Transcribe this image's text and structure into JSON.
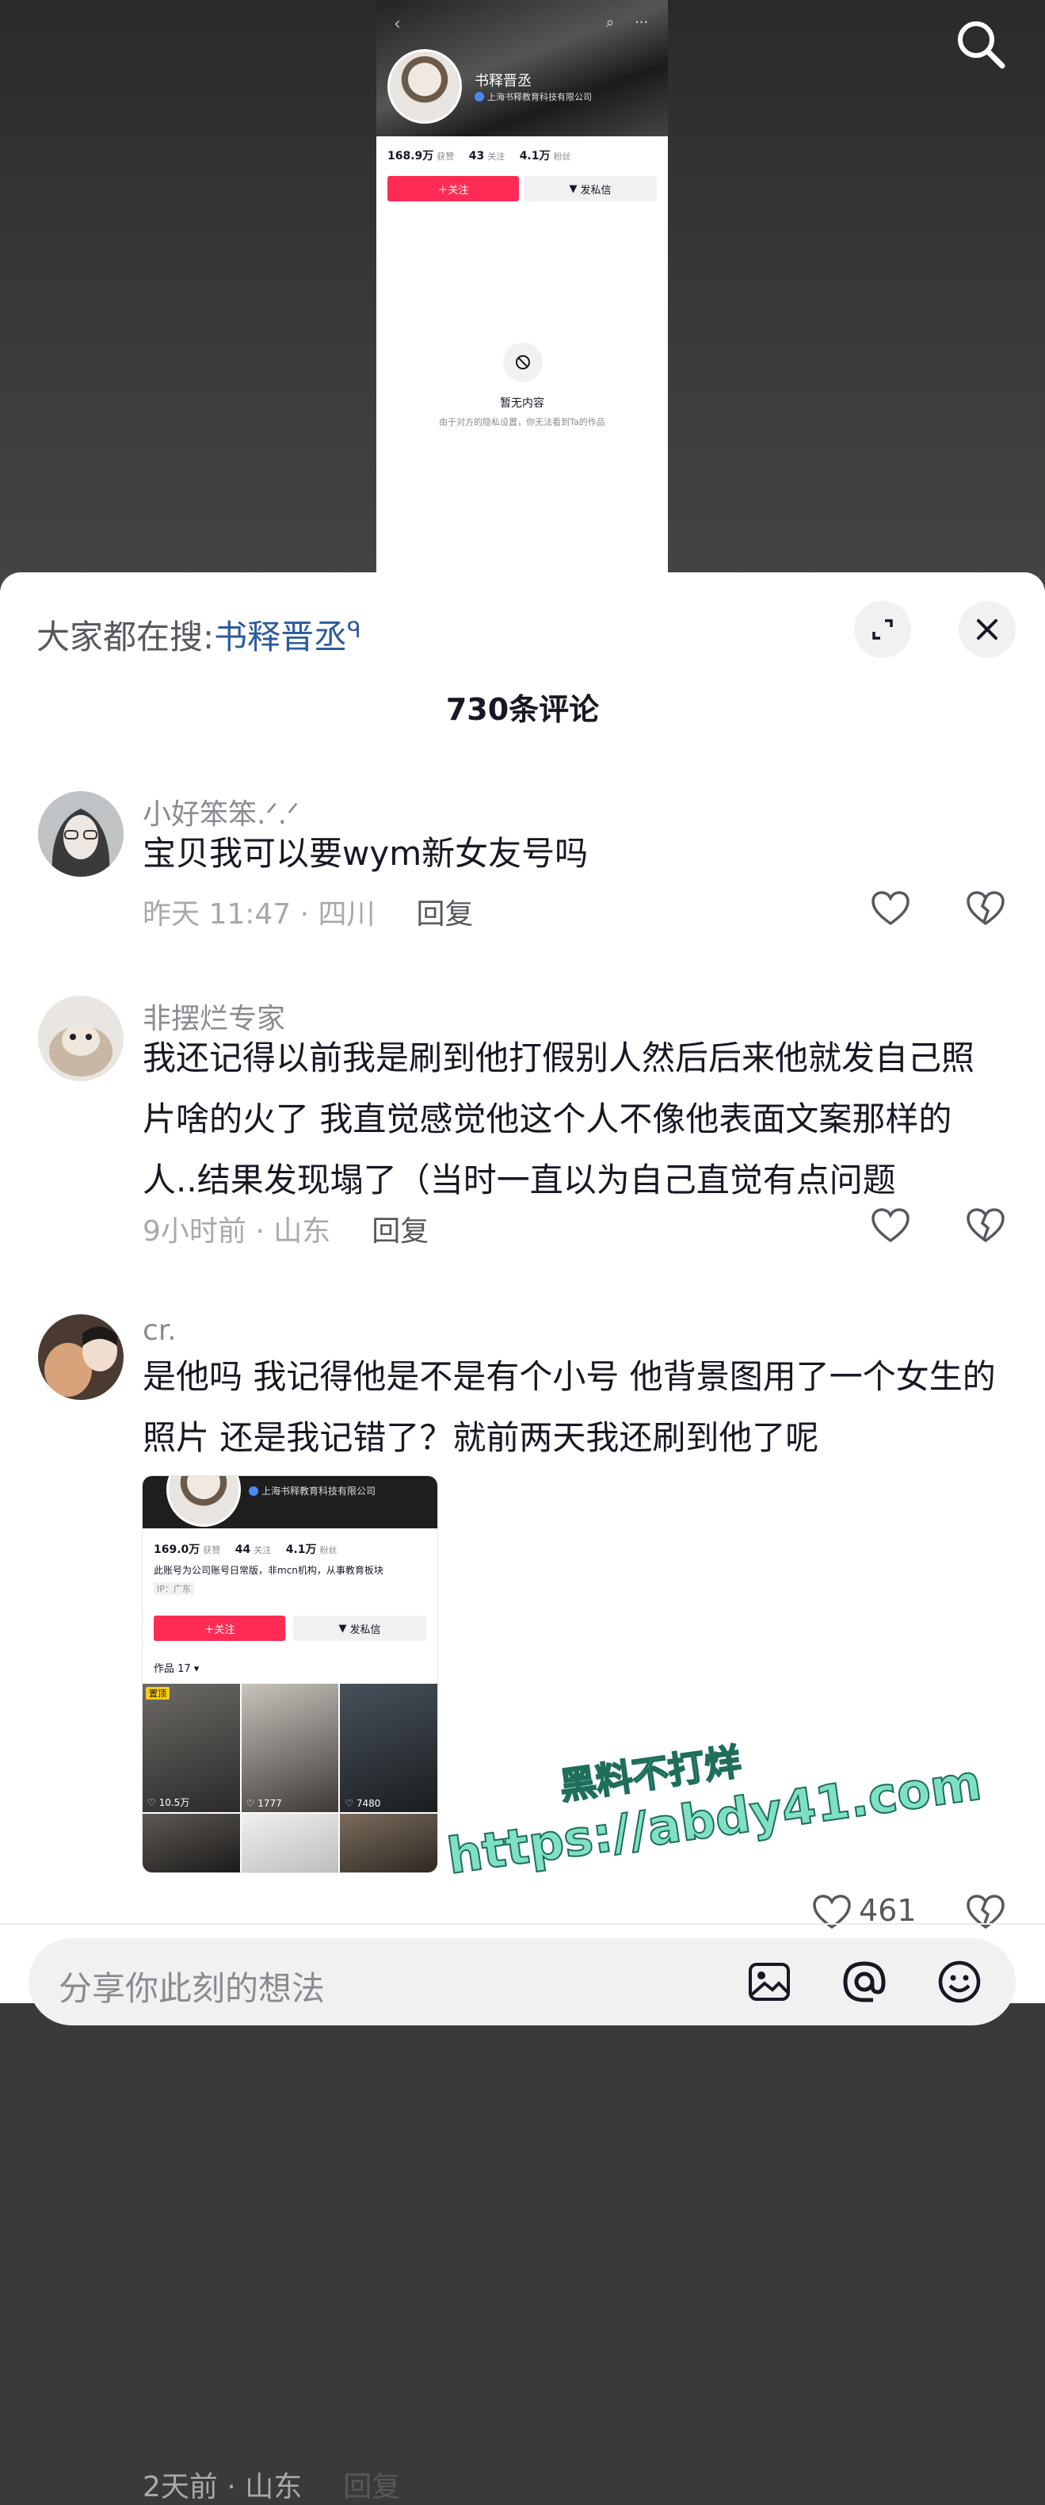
{
  "embedded_profile": {
    "name": "书释晋丞",
    "company": "上海书释教育科技有限公司",
    "stats": [
      {
        "value": "168.9万",
        "label": "获赞"
      },
      {
        "value": "43",
        "label": "关注"
      },
      {
        "value": "4.1万",
        "label": "粉丝"
      }
    ],
    "follow_label": "＋关注",
    "message_label": "发私信",
    "empty_title": "暂无内容",
    "empty_sub": "由于对方的隐私设置，你无法看到Ta的作品"
  },
  "sheet": {
    "search_prefix": "大家都在搜:",
    "search_keyword": "书释晋丞",
    "comment_count": "730条评论",
    "input_placeholder": "分享你此刻的想法"
  },
  "comments": [
    {
      "user": "小好笨笨.ᐟ.ᐟ",
      "text": "宝贝我可以要wym新女友号吗",
      "time": "昨天 11:47 · 四川",
      "reply": "回复"
    },
    {
      "user": "非摆烂专家",
      "text": "我还记得以前我是刷到他打假别人然后后来他就发自己照片啥的火了 我直觉感觉他这个人不像他表面文案那样的人..结果发现塌了（当时一直以为自己直觉有点问题",
      "time": "9小时前 · 山东",
      "reply": "回复"
    },
    {
      "user": "cr.",
      "text": "是他吗 我记得他是不是有个小号 他背景图用了一个女生的照片 还是我记错了？就前两天我还刷到他了呢",
      "time": "2天前 · 山东",
      "reply": "回复",
      "likes": "461",
      "image": {
        "company": "上海书释教育科技有限公司",
        "stats": [
          {
            "value": "169.0万",
            "label": "获赞"
          },
          {
            "value": "44",
            "label": "关注"
          },
          {
            "value": "4.1万",
            "label": "粉丝"
          }
        ],
        "bio": "此账号为公司账号日常版，非mcn机构，从事教育板块",
        "ip": "IP：广东",
        "follow_label": "＋关注",
        "message_label": "发私信",
        "works_label": "作品 17 ▾",
        "pinned_label": "置顶",
        "cell_likes": [
          "10.5万",
          "1777",
          "7480"
        ]
      }
    }
  ],
  "watermark": {
    "line1": "黑料不打烊",
    "line2": "https://abdy41.com"
  },
  "colors": {
    "accent_red": "#fe2c55",
    "link_blue": "#2b5a9c",
    "watermark_fill": "#7fe0c4"
  }
}
